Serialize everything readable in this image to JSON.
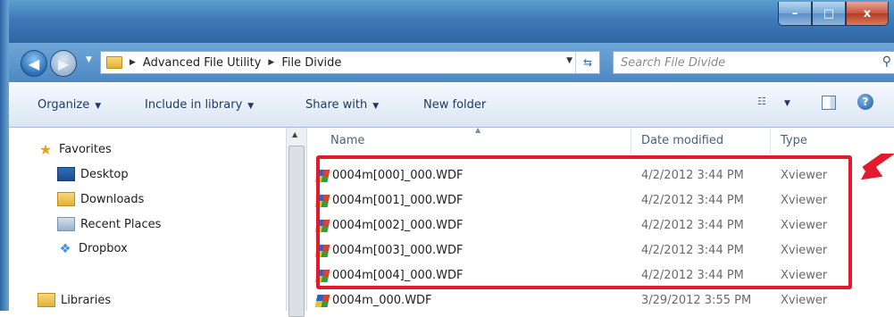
{
  "window": {
    "caption_buttons": {
      "minimize": "–",
      "maximize": "□",
      "close": "x"
    }
  },
  "address": {
    "breadcrumb": [
      "Advanced File Utility",
      "File Divide"
    ],
    "search_placeholder": "Search File Divide"
  },
  "toolbar": {
    "organize": "Organize",
    "include_in_library": "Include in library",
    "share_with": "Share with",
    "new_folder": "New folder"
  },
  "nav": {
    "favorites": "Favorites",
    "items": [
      "Desktop",
      "Downloads",
      "Recent Places",
      "Dropbox"
    ],
    "libraries": "Libraries"
  },
  "files": {
    "columns": {
      "name": "Name",
      "date": "Date modified",
      "type": "Type"
    },
    "rows": [
      {
        "name": "0004m[000]_000.WDF",
        "date": "4/2/2012 3:44 PM",
        "type": "Xviewer"
      },
      {
        "name": "0004m[001]_000.WDF",
        "date": "4/2/2012 3:44 PM",
        "type": "Xviewer"
      },
      {
        "name": "0004m[002]_000.WDF",
        "date": "4/2/2012 3:44 PM",
        "type": "Xviewer"
      },
      {
        "name": "0004m[003]_000.WDF",
        "date": "4/2/2012 3:44 PM",
        "type": "Xviewer"
      },
      {
        "name": "0004m[004]_000.WDF",
        "date": "4/2/2012 3:44 PM",
        "type": "Xviewer"
      },
      {
        "name": "0004m_000.WDF",
        "date": "3/29/2012 3:55 PM",
        "type": "Xviewer"
      }
    ]
  },
  "colors": {
    "highlight": "#e21a2c",
    "titlebar": "#3e7ab8"
  }
}
